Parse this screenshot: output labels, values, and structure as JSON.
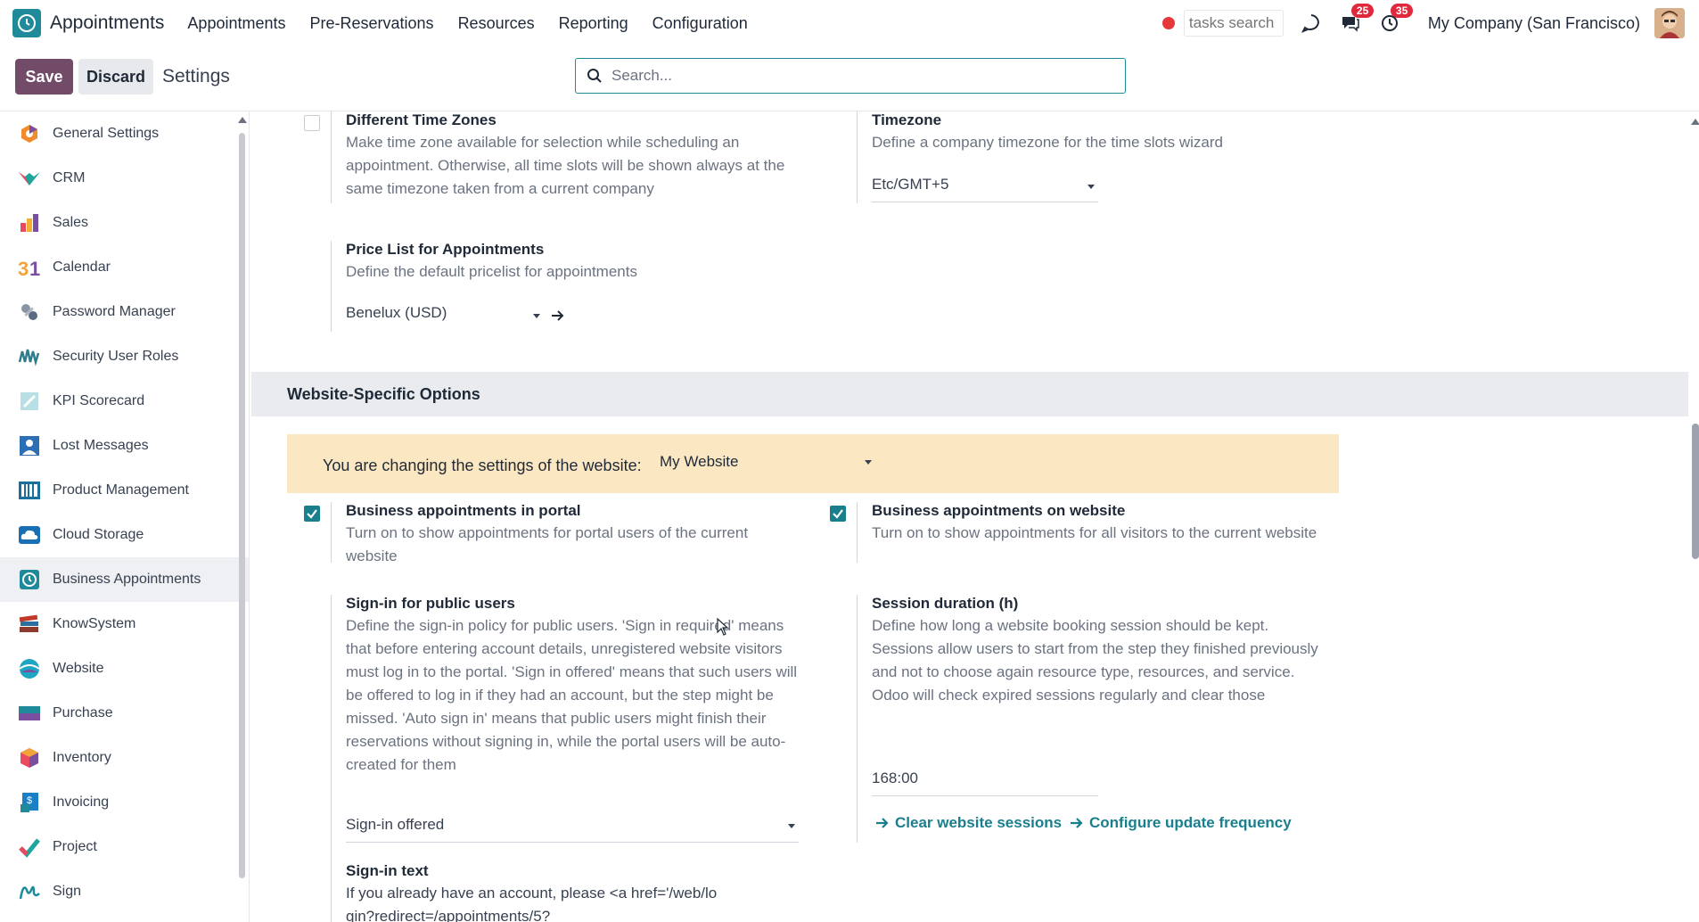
{
  "navbar": {
    "app_name": "Appointments",
    "menu": [
      "Appointments",
      "Pre-Reservations",
      "Resources",
      "Reporting",
      "Configuration"
    ],
    "tasks_search_placeholder": "tasks search",
    "messages_badge": "25",
    "activities_badge": "35",
    "company": "My Company (San Francisco)"
  },
  "control": {
    "save_label": "Save",
    "discard_label": "Discard",
    "title": "Settings",
    "search_placeholder": "Search..."
  },
  "sidebar": {
    "items": [
      {
        "label": "General Settings",
        "icon": "general-settings-icon"
      },
      {
        "label": "CRM",
        "icon": "crm-icon"
      },
      {
        "label": "Sales",
        "icon": "sales-icon"
      },
      {
        "label": "Calendar",
        "icon": "calendar-icon"
      },
      {
        "label": "Password Manager",
        "icon": "password-manager-icon"
      },
      {
        "label": "Security User Roles",
        "icon": "security-roles-icon"
      },
      {
        "label": "KPI Scorecard",
        "icon": "kpi-icon"
      },
      {
        "label": "Lost Messages",
        "icon": "lost-messages-icon"
      },
      {
        "label": "Product Management",
        "icon": "product-management-icon"
      },
      {
        "label": "Cloud Storage",
        "icon": "cloud-storage-icon"
      },
      {
        "label": "Business Appointments",
        "icon": "appointments-icon",
        "active": true
      },
      {
        "label": "KnowSystem",
        "icon": "knowsystem-icon"
      },
      {
        "label": "Website",
        "icon": "website-icon"
      },
      {
        "label": "Purchase",
        "icon": "purchase-icon"
      },
      {
        "label": "Inventory",
        "icon": "inventory-icon"
      },
      {
        "label": "Invoicing",
        "icon": "invoicing-icon"
      },
      {
        "label": "Project",
        "icon": "project-icon"
      },
      {
        "label": "Sign",
        "icon": "sign-icon"
      }
    ]
  },
  "settings": {
    "timezones": {
      "title": "Different Time Zones",
      "desc": "Make time zone available for selection while scheduling an appointment. Otherwise, all time slots will be shown always at the same timezone taken from a current company",
      "checked": false
    },
    "timezone": {
      "title": "Timezone",
      "desc": "Define a company timezone for the time slots wizard",
      "value": "Etc/GMT+5"
    },
    "pricelist": {
      "title": "Price List for Appointments",
      "desc": "Define the default pricelist for appointments",
      "value": "Benelux (USD)"
    },
    "website_section": "Website-Specific Options",
    "website_banner_label": "You are changing the settings of the website:",
    "website_value": "My Website",
    "portal": {
      "title": "Business appointments in portal",
      "desc": "Turn on to show appointments for portal users of the current website",
      "checked": true
    },
    "on_website": {
      "title": "Business appointments on website",
      "desc": "Turn on to show appointments for all visitors to the current website",
      "checked": true
    },
    "signin": {
      "title": "Sign-in for public users",
      "desc": "Define the sign-in policy for public users. 'Sign in required' means that before entering account details, unregistered website visitors must log in to the portal. 'Sign in offered' means that such users will be offered to log in if they had an account, but the step might be missed. 'Auto sign in' means that public users might finish their reservations without signing in, while the portal users will be auto-created for them",
      "value": "Sign-in offered"
    },
    "session": {
      "title": "Session duration (h)",
      "desc": "Define how long a website booking session should be kept. Sessions allow users to start from the step they finished previously and not to choose again resource type, resources, and service. Odoo will check expired sessions regularly and clear those",
      "value": "168:00"
    },
    "clear_sessions": "Clear website sessions",
    "configure_frequency": "Configure update frequency",
    "signin_text": {
      "title": "Sign-in text",
      "desc": "If you already have an account, please <a href='/web/login?redirect=/appointments/5?"
    }
  }
}
